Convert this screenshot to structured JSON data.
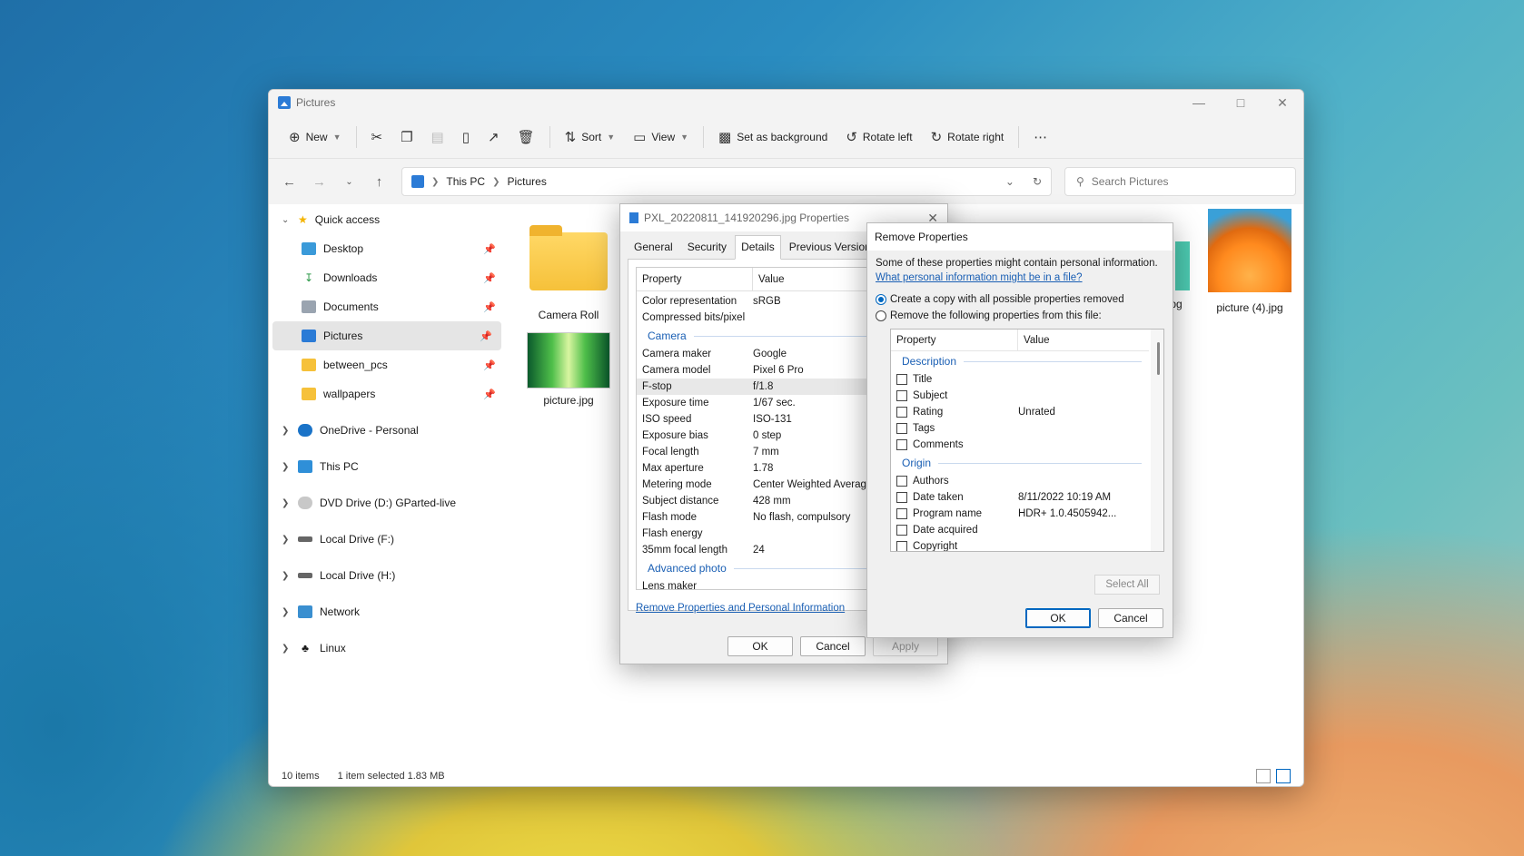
{
  "window": {
    "title": "Pictures"
  },
  "toolbar": {
    "new_label": "New",
    "sort_label": "Sort",
    "view_label": "View",
    "set_bg_label": "Set as background",
    "rotate_left_label": "Rotate left",
    "rotate_right_label": "Rotate right"
  },
  "address": {
    "crumb1": "This PC",
    "crumb2": "Pictures"
  },
  "search": {
    "placeholder": "Search Pictures"
  },
  "sidebar": {
    "quick_access": "Quick access",
    "desktop": "Desktop",
    "downloads": "Downloads",
    "documents": "Documents",
    "pictures": "Pictures",
    "between_pcs": "between_pcs",
    "wallpapers": "wallpapers",
    "onedrive": "OneDrive - Personal",
    "this_pc": "This PC",
    "dvd": "DVD Drive (D:) GParted-live",
    "local_f": "Local Drive (F:)",
    "local_h": "Local Drive (H:)",
    "network": "Network",
    "linux": "Linux"
  },
  "files": {
    "camera_roll": "Camera Roll",
    "picture": "picture.jpg",
    "partial": "pg",
    "picture4": "picture (4).jpg"
  },
  "status": {
    "count": "10 items",
    "selected": "1 item selected  1.83 MB"
  },
  "props": {
    "title": "PXL_20220811_141920296.jpg Properties",
    "tabs": [
      "General",
      "Security",
      "Details",
      "Previous Versions"
    ],
    "head_property": "Property",
    "head_value": "Value",
    "rows_top": [
      {
        "k": "Color representation",
        "v": "sRGB"
      },
      {
        "k": "Compressed bits/pixel",
        "v": ""
      }
    ],
    "group_camera": "Camera",
    "rows_camera": [
      {
        "k": "Camera maker",
        "v": "Google"
      },
      {
        "k": "Camera model",
        "v": "Pixel 6 Pro"
      },
      {
        "k": "F-stop",
        "v": "f/1.8"
      },
      {
        "k": "Exposure time",
        "v": "1/67 sec."
      },
      {
        "k": "ISO speed",
        "v": "ISO-131"
      },
      {
        "k": "Exposure bias",
        "v": "0 step"
      },
      {
        "k": "Focal length",
        "v": "7 mm"
      },
      {
        "k": "Max aperture",
        "v": "1.78"
      },
      {
        "k": "Metering mode",
        "v": "Center Weighted Averag"
      },
      {
        "k": "Subject distance",
        "v": "428 mm"
      },
      {
        "k": "Flash mode",
        "v": "No flash, compulsory"
      },
      {
        "k": "Flash energy",
        "v": ""
      },
      {
        "k": "35mm focal length",
        "v": "24"
      }
    ],
    "group_advanced": "Advanced photo",
    "row_partial": "Lens maker",
    "remove_link": "Remove Properties and Personal Information",
    "ok": "OK",
    "cancel": "Cancel",
    "apply": "Apply"
  },
  "remove": {
    "title": "Remove Properties",
    "intro": "Some of these properties might contain personal information.",
    "link": "What personal information might be in a file?",
    "opt1": "Create a copy with all possible properties removed",
    "opt2": "Remove the following properties from this file:",
    "head_property": "Property",
    "head_value": "Value",
    "group_description": "Description",
    "desc_rows": [
      {
        "k": "Title",
        "v": ""
      },
      {
        "k": "Subject",
        "v": ""
      },
      {
        "k": "Rating",
        "v": "Unrated"
      },
      {
        "k": "Tags",
        "v": ""
      },
      {
        "k": "Comments",
        "v": ""
      }
    ],
    "group_origin": "Origin",
    "origin_rows": [
      {
        "k": "Authors",
        "v": ""
      },
      {
        "k": "Date taken",
        "v": "8/11/2022 10:19 AM"
      },
      {
        "k": "Program name",
        "v": "HDR+ 1.0.4505942..."
      },
      {
        "k": "Date acquired",
        "v": ""
      },
      {
        "k": "Copyright",
        "v": ""
      }
    ],
    "select_all": "Select All",
    "ok": "OK",
    "cancel": "Cancel"
  }
}
